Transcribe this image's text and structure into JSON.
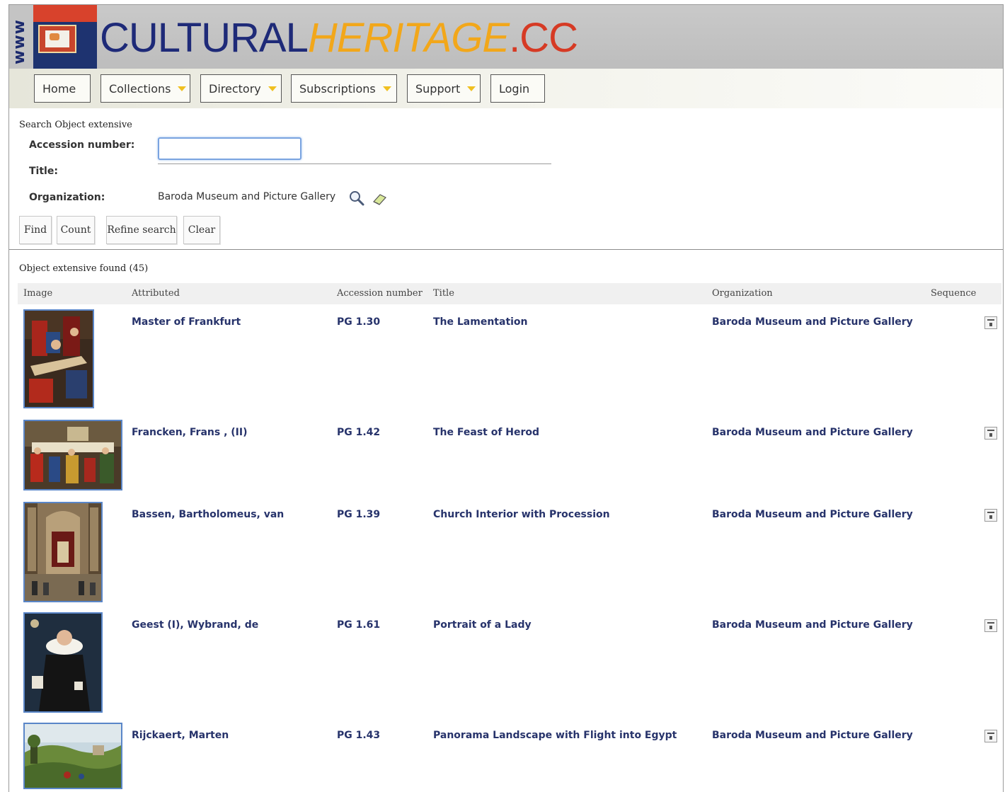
{
  "header": {
    "www": "www",
    "brand_part1": "CULTURAL",
    "brand_part2": "HERITAGE",
    "brand_part3": ".CC",
    "colors": {
      "navy": "#1e2a78",
      "orange": "#f2a71a",
      "red": "#d63a24"
    }
  },
  "nav": {
    "items": [
      {
        "label": "Home",
        "has_dropdown": false
      },
      {
        "label": "Collections",
        "has_dropdown": true
      },
      {
        "label": "Directory",
        "has_dropdown": true
      },
      {
        "label": "Subscriptions",
        "has_dropdown": true
      },
      {
        "label": "Support",
        "has_dropdown": true
      },
      {
        "label": "Login",
        "has_dropdown": false
      }
    ]
  },
  "search": {
    "heading": "Search Object extensive",
    "accession_label": "Accession number:",
    "accession_value": "",
    "title_label": "Title:",
    "title_value": "",
    "organization_label": "Organization:",
    "organization_value": "Baroda Museum and Picture Gallery",
    "organization_search_icon": "magnifier-icon",
    "organization_clear_icon": "eraser-icon",
    "buttons": {
      "find": "Find",
      "count": "Count",
      "refine": "Refine search",
      "clear": "Clear"
    }
  },
  "results": {
    "summary": "Object extensive found (45)",
    "columns": {
      "image": "Image",
      "attributed": "Attributed",
      "accession": "Accession number",
      "title": "Title",
      "organization": "Organization",
      "sequence": "Sequence"
    },
    "rows": [
      {
        "attributed": "Master of Frankfurt",
        "accession": "PG 1.30",
        "title": "The Lamentation",
        "organization": "Baroda Museum and Picture Gallery"
      },
      {
        "attributed": "Francken, Frans , (II)",
        "accession": "PG 1.42",
        "title": "The Feast of Herod",
        "organization": "Baroda Museum and Picture Gallery"
      },
      {
        "attributed": "Bassen, Bartholomeus, van",
        "accession": "PG 1.39",
        "title": "Church Interior with Procession",
        "organization": "Baroda Museum and Picture Gallery"
      },
      {
        "attributed": "Geest (I), Wybrand, de",
        "accession": "PG 1.61",
        "title": "Portrait of a Lady",
        "organization": "Baroda Museum and Picture Gallery"
      },
      {
        "attributed": "Rijckaert, Marten",
        "accession": "PG 1.43",
        "title": "Panorama Landscape with Flight into Egypt",
        "organization": "Baroda Museum and Picture Gallery"
      }
    ]
  }
}
